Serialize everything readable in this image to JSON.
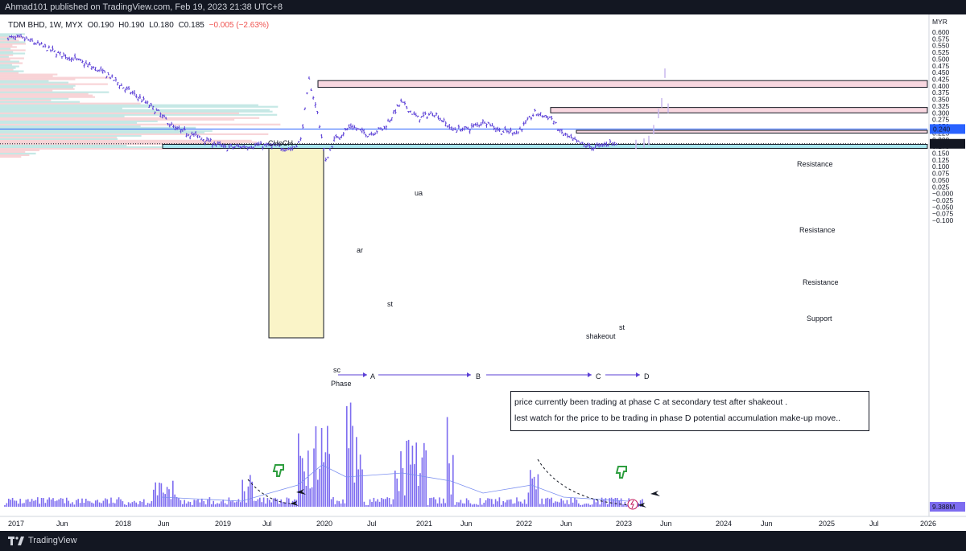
{
  "header": {
    "published": "Ahmad101 published on TradingView.com, Feb 19, 2023 21:38 UTC+8"
  },
  "legend": {
    "symbol": "TDM BHD, 1W, MYX",
    "open": "O0.190",
    "high": "H0.190",
    "low": "L0.180",
    "close": "C0.185",
    "change": "−0.005 (−2.63%)"
  },
  "footer": {
    "brand": "TradingView"
  },
  "colors": {
    "candle": "#5b3fd6",
    "projection": "#c9b8ee",
    "resistance": "#f8d7e0",
    "support": "#a8e6ee",
    "choch": "#faf4c8",
    "volume": "#7d6cf0",
    "vp_pink": "#f6c9cd",
    "vp_teal": "#b7e2df",
    "current_price": "#131722",
    "ref_line": "#2962ff"
  },
  "annotations": {
    "choch": "CHoCH",
    "ar": "ar",
    "ua": "ua",
    "st1": "st",
    "sc": "sc",
    "phase": "Phase",
    "shakeout": "shakeout",
    "st2": "st",
    "phase_a": "A",
    "phase_b": "B",
    "phase_c": "C",
    "phase_d": "D",
    "res1": "Resistance",
    "res2": "Resistance",
    "res3": "Resistance",
    "support": "Support",
    "note_line1": "price currently been trading at phase C at secondary test after shakeout .",
    "note_line2": "lest watch for the price to be trading in phase D potential accumulation make-up move.."
  },
  "icons": [
    "thumbs-down-icon",
    "airplane-icon",
    "lightning-icon"
  ],
  "chart_data": {
    "type": "candlestick",
    "currency": "MYR",
    "interval": "1W",
    "x_ticks": [
      "2017",
      "Jun",
      "2018",
      "Jun",
      "2019",
      "Jul",
      "2020",
      "Jul",
      "2021",
      "Jun",
      "2022",
      "Jun",
      "2023",
      "Jun",
      "2024",
      "Jun",
      "2025",
      "Jul",
      "2026"
    ],
    "y_ticks": [
      "0.600",
      "0.575",
      "0.550",
      "0.525",
      "0.500",
      "0.475",
      "0.450",
      "0.425",
      "0.400",
      "0.375",
      "0.350",
      "0.325",
      "0.300",
      "0.275",
      "0.250",
      "0.225",
      "0.200",
      "0.175",
      "0.150",
      "0.125",
      "0.100",
      "0.075",
      "0.050",
      "0.025",
      "−0.000",
      "−0.025",
      "−0.050",
      "−0.075",
      "−0.100"
    ],
    "ylim": [
      -0.1,
      0.605
    ],
    "current_price": "0.185",
    "ref_price": "0.240",
    "volume_label": "9.388M",
    "series": [
      {
        "name": "close",
        "points": [
          [
            "2017-01",
            0.58
          ],
          [
            "2017-03",
            0.575
          ],
          [
            "2017-05",
            0.55
          ],
          [
            "2017-07",
            0.52
          ],
          [
            "2017-09",
            0.5
          ],
          [
            "2017-11",
            0.47
          ],
          [
            "2018-01",
            0.44
          ],
          [
            "2018-03",
            0.39
          ],
          [
            "2018-05",
            0.35
          ],
          [
            "2018-07",
            0.3
          ],
          [
            "2018-09",
            0.24
          ],
          [
            "2018-11",
            0.22
          ],
          [
            "2019-01",
            0.195
          ],
          [
            "2019-03",
            0.17
          ],
          [
            "2019-05",
            0.175
          ],
          [
            "2019-07",
            0.18
          ],
          [
            "2019-09",
            0.175
          ],
          [
            "2019-11",
            0.165
          ],
          [
            "2019-12",
            0.2
          ],
          [
            "2020-01",
            0.42
          ],
          [
            "2020-02",
            0.3
          ],
          [
            "2020-03",
            0.12
          ],
          [
            "2020-04",
            0.2
          ],
          [
            "2020-06",
            0.25
          ],
          [
            "2020-08",
            0.22
          ],
          [
            "2020-10",
            0.245
          ],
          [
            "2020-12",
            0.34
          ],
          [
            "2021-02",
            0.28
          ],
          [
            "2021-04",
            0.3
          ],
          [
            "2021-06",
            0.24
          ],
          [
            "2021-08",
            0.24
          ],
          [
            "2021-10",
            0.27
          ],
          [
            "2021-12",
            0.23
          ],
          [
            "2022-02",
            0.23
          ],
          [
            "2022-04",
            0.3
          ],
          [
            "2022-06",
            0.28
          ],
          [
            "2022-07",
            0.23
          ],
          [
            "2022-09",
            0.19
          ],
          [
            "2022-11",
            0.17
          ],
          [
            "2023-01",
            0.19
          ],
          [
            "2023-02",
            0.185
          ]
        ]
      }
    ],
    "zones": [
      {
        "label": "Resistance",
        "low": 0.395,
        "high": 0.42
      },
      {
        "label": "Resistance",
        "low": 0.3,
        "high": 0.32
      },
      {
        "label": "Resistance",
        "low": 0.225,
        "high": 0.235
      },
      {
        "label": "Support",
        "low": 0.168,
        "high": 0.183
      }
    ]
  }
}
